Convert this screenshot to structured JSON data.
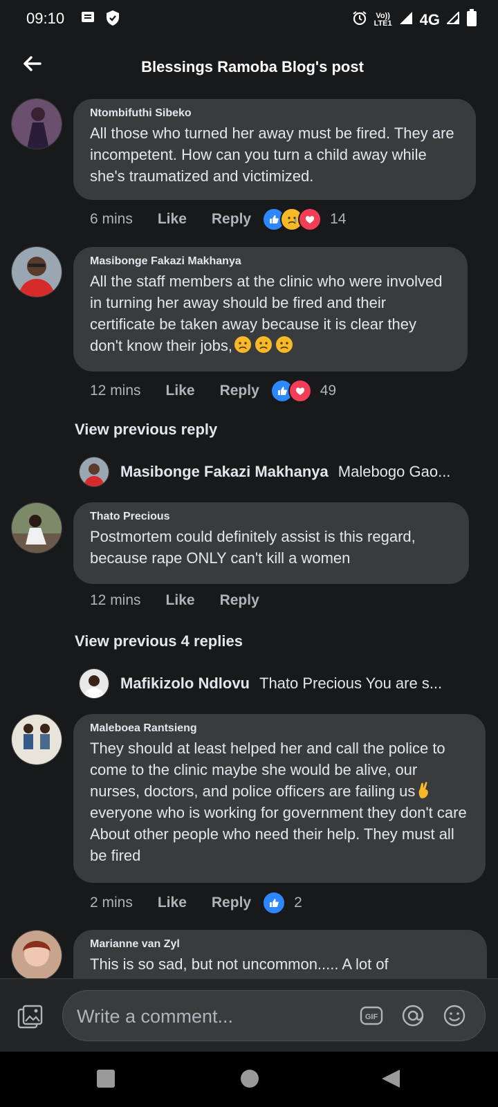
{
  "status": {
    "time": "09:10",
    "network": "4G",
    "volte_top": "Vo))",
    "volte_bottom": "LTE1"
  },
  "header": {
    "title": "Blessings Ramoba Blog's post"
  },
  "comments": [
    {
      "name": "Ntombifuthi Sibeko",
      "text": "All those who turned her away must be fired. They are incompetent.  How can you turn a child away while she's traumatized and victimized.",
      "time": "6 mins",
      "like": "Like",
      "reply": "Reply",
      "reactions": [
        "like",
        "sad",
        "love"
      ],
      "count": "14"
    },
    {
      "name": "Masibonge Fakazi Makhanya",
      "text": "All the staff members at the clinic who were involved in turning her away should be fired and their certificate be taken away because it is clear they don't know their jobs,",
      "time": "12 mins",
      "like": "Like",
      "reply": "Reply",
      "reactions": [
        "like",
        "love"
      ],
      "count": "49",
      "view_previous": "View previous reply",
      "reply_preview": {
        "name": "Masibonge Fakazi Makhanya",
        "text": "Malebogo Gao..."
      }
    },
    {
      "name": "Thato Precious",
      "text": "Postmortem could definitely assist is this regard, because rape ONLY can't kill a women",
      "time": "12 mins",
      "like": "Like",
      "reply": "Reply",
      "view_previous": "View previous 4 replies",
      "reply_preview": {
        "name": "Mafikizolo Ndlovu",
        "text": "Thato Precious You are s..."
      }
    },
    {
      "name": "Maleboea Rantsieng",
      "text_a": "They should at least helped her and call the police to come to the clinic maybe she would be alive, our nurses, doctors, and police officers are failing us",
      "text_b": "everyone who is working for government they don't care About other people who need their help. They must all be fired",
      "time": "2 mins",
      "like": "Like",
      "reply": "Reply",
      "reactions": [
        "like"
      ],
      "count": "2"
    },
    {
      "name": "Marianne van Zyl",
      "text": "This is so sad, but not uncommon..... A lot of"
    }
  ],
  "composer": {
    "placeholder": "Write a comment..."
  },
  "colors": {
    "background": "#18191a",
    "bubble": "#3a3b3c",
    "like_blue": "#2d88ff",
    "love_red": "#f33e58"
  }
}
